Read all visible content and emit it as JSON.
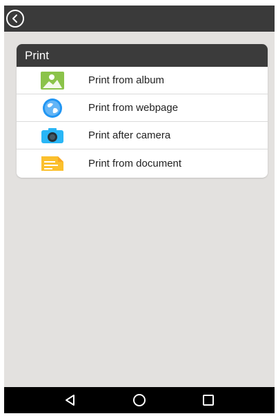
{
  "header": {
    "title": "Print"
  },
  "menu": {
    "items": [
      {
        "label": "Print from album",
        "icon": "album-image-icon",
        "color": "#8bc34a"
      },
      {
        "label": "Print from webpage",
        "icon": "globe-icon",
        "color": "#2196f3"
      },
      {
        "label": "Print after camera",
        "icon": "camera-icon",
        "color": "#29b6f6"
      },
      {
        "label": "Print from document",
        "icon": "document-icon",
        "color": "#fbc02d"
      }
    ]
  },
  "colors": {
    "topbar": "#3a3a3a",
    "panel_header": "#3b3b3b",
    "background": "#e3e1df",
    "navbar": "#000000"
  },
  "navbar": {
    "buttons": [
      "back-triangle-icon",
      "home-circle-icon",
      "recents-square-icon"
    ]
  }
}
